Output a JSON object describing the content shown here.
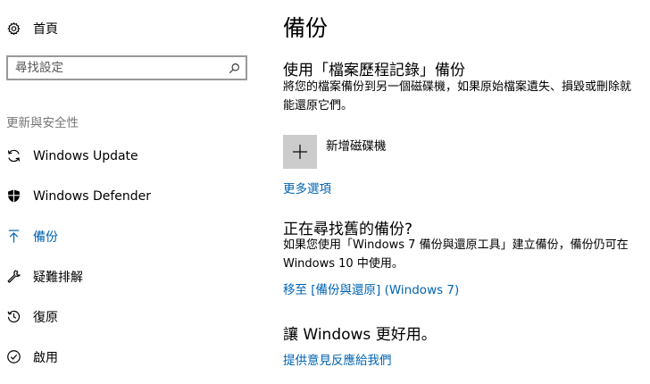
{
  "sidebar": {
    "home_label": "首頁",
    "search_placeholder": "尋找設定",
    "section_heading": "更新與安全性",
    "items": [
      {
        "label": "Windows Update",
        "icon": "sync-icon"
      },
      {
        "label": "Windows Defender",
        "icon": "shield-icon"
      },
      {
        "label": "備份",
        "icon": "upload-arrow-icon",
        "selected": true
      },
      {
        "label": "疑難排解",
        "icon": "wrench-icon"
      },
      {
        "label": "復原",
        "icon": "history-icon"
      },
      {
        "label": "啟用",
        "icon": "check-circle-icon"
      }
    ]
  },
  "main": {
    "title": "備份",
    "file_history": {
      "heading": "使用「檔案歷程記錄」備份",
      "description": "將您的檔案備份到另一個磁碟機，如果原始檔案遺失、損毀或刪除就能還原它們。",
      "add_drive_label": "新增磁碟機",
      "more_options_link": "更多選項"
    },
    "older_backup": {
      "heading": "正在尋找舊的備份?",
      "description": "如果您使用「Windows 7 備份與還原工具」建立備份，備份仍可在 Windows 10 中使用。",
      "link": "移至 [備份與還原] (Windows 7)"
    },
    "feedback": {
      "heading": "讓 Windows 更好用。",
      "link": "提供意見反應給我們"
    }
  },
  "colors": {
    "accent": "#0063b1",
    "section_heading": "#767676",
    "search_border": "#999999",
    "add_button_bg": "#cccccc"
  }
}
